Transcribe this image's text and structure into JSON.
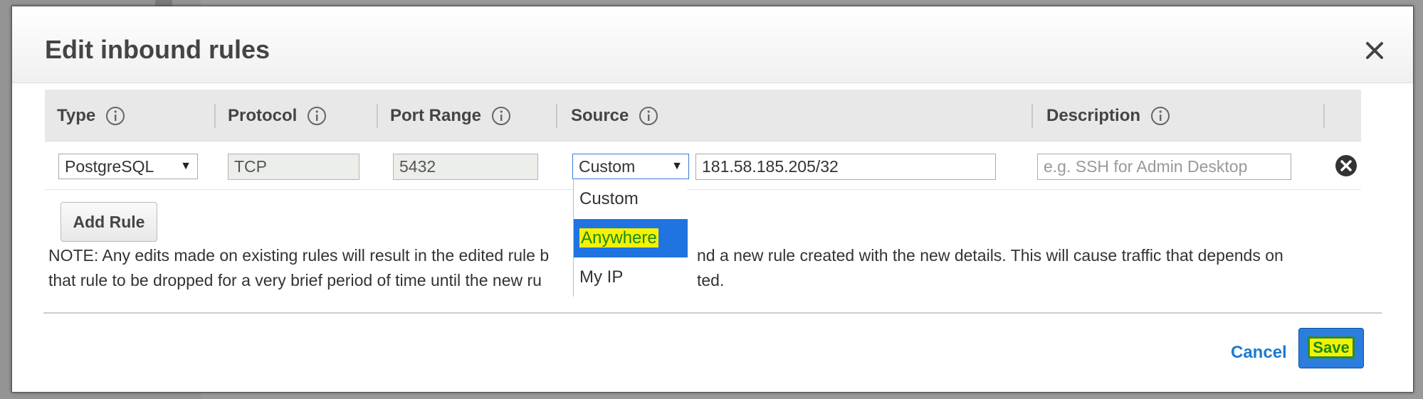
{
  "modal": {
    "title": "Edit inbound rules"
  },
  "table": {
    "headers": {
      "type": "Type",
      "protocol": "Protocol",
      "port_range": "Port Range",
      "source": "Source",
      "description": "Description"
    },
    "rows": [
      {
        "type": "PostgreSQL",
        "protocol": "TCP",
        "port_range": "5432",
        "source_mode": "Custom",
        "source_value": "181.58.185.205/32",
        "description_placeholder": "e.g. SSH for Admin Desktop"
      }
    ]
  },
  "source_dropdown": {
    "options": [
      "Custom",
      "Anywhere",
      "My IP"
    ],
    "highlighted": "Anywhere"
  },
  "buttons": {
    "add_rule": "Add Rule",
    "cancel": "Cancel",
    "save": "Save"
  },
  "note": {
    "line1a": "NOTE: Any edits made on existing rules will result in the edited rule b",
    "line1b": "nd a new rule created with the new details. This will cause traffic that depends on",
    "line2a": "that rule to be dropped for a very brief period of time until the new ru",
    "line2b": "ted."
  },
  "colors": {
    "primary": "#2b7ede",
    "link": "#1c7ad1",
    "highlight": "#f5f200",
    "highlight_text": "#1a8a1a"
  },
  "icons": {
    "close": "close-icon",
    "info": "info-icon",
    "remove": "remove-circle-icon",
    "caret": "caret-down-icon"
  }
}
